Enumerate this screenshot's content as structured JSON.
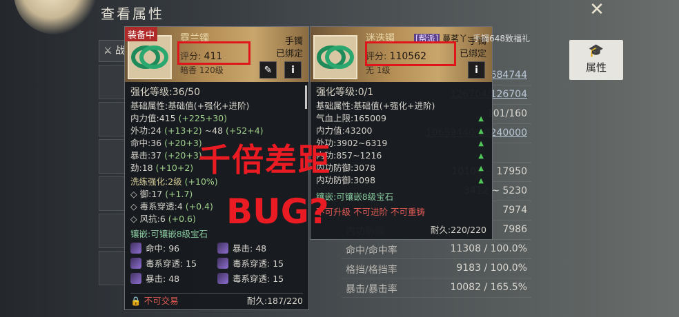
{
  "window": {
    "title": "查看属性"
  },
  "left_tab": {
    "label": "战"
  },
  "right_button": {
    "label": "属性"
  },
  "card1": {
    "badge": "装备中",
    "name": "霓兰镯",
    "score_label": "评分:",
    "score": "411",
    "sub": "暗香   120级",
    "type": "手镯",
    "bound": "已绑定",
    "enhance": "强化等级:36/50",
    "base_label": "基础属性:基础值(+强化+进阶)",
    "attrs": [
      {
        "k": "内力值:",
        "v": "415",
        "g": " (+225+30)"
      },
      {
        "k": "外功:",
        "v": "24",
        "g": " (+13+2)",
        "v2": " ~48",
        "g2": " (+52+4)"
      },
      {
        "k": "命中:",
        "v": "36",
        "g": " (+20+3)"
      },
      {
        "k": "暴击:",
        "v": "37",
        "g": " (+20+3)"
      },
      {
        "k": "劲:",
        "v": "18",
        "g": " (+10+2)"
      }
    ],
    "refine": "洗练强化:2级",
    "refine_pct": " (+10%)",
    "refine_attrs": [
      {
        "k": "◇ 御:",
        "v": "17",
        "g": " (+1.7)"
      },
      {
        "k": "◇ 毒系穿透:",
        "v": "4",
        "g": " (+0.4)"
      },
      {
        "k": "◇ 风抗:",
        "v": "6",
        "g": " (+0.6)"
      }
    ],
    "inlay": "镶嵌:可镶嵌8级宝石",
    "gems": [
      {
        "label": "命中:",
        "value": "96"
      },
      {
        "label": "暴击:",
        "value": "48"
      },
      {
        "label": "毒系穿透:",
        "value": "15"
      },
      {
        "label": "毒系穿透:",
        "value": "15"
      },
      {
        "label": "暴击:",
        "value": "48"
      },
      {
        "label": "毒系穿透:",
        "value": "15"
      }
    ],
    "trade": "不可交易",
    "durability": "耐久:187/220"
  },
  "card2": {
    "name": "迷迭镯",
    "guild_tag": "[帮派]",
    "guild_text": "蔓茗丫:",
    "type": "手镯",
    "bound": "已绑定",
    "score_label": "评分:",
    "score": "110562",
    "sub": "无   1级",
    "enhance": "强化等级:0/1",
    "base_label": "基础属性:基础值(+强化+进阶)",
    "attrs": [
      {
        "k": "气血上限:",
        "v": "165009"
      },
      {
        "k": "内力值:",
        "v": "43200"
      },
      {
        "k": "外功:",
        "v": "3902~6319"
      },
      {
        "k": "内功:",
        "v": "857~1216"
      },
      {
        "k": "内功防御:",
        "v": "3078"
      },
      {
        "k": "内功防御:",
        "v": "3098"
      }
    ],
    "inlay": "镶嵌:可镶嵌8级宝石",
    "restrict": "不可升级 不可进阶 不可重铸",
    "durability": "耐久:220/220"
  },
  "bg_header_text": "手镯648致福礼",
  "stats": [
    {
      "label": "",
      "value": "/684744",
      "ul": true
    },
    {
      "label": "",
      "value": "126704/126704",
      "ul": true
    },
    {
      "label": "",
      "value": "101/160",
      "ul": false
    },
    {
      "label": "",
      "value": "10659440/10240000",
      "ul": true
    },
    {
      "label": "",
      "value": "",
      "ul": false
    },
    {
      "label": "",
      "value": "10104 ~ 17950",
      "ul": false
    },
    {
      "label": "",
      "value": "3412 ~ 5230",
      "ul": false
    },
    {
      "label": "",
      "value": "7974",
      "ul": false
    },
    {
      "label": "内功防御",
      "value": "7986",
      "ul": false
    },
    {
      "label": "命中/命中率",
      "value": "11308 / 100.0%",
      "ul": false
    },
    {
      "label": "格挡/格挡率",
      "value": "9183 / 100.0%",
      "ul": false
    },
    {
      "label": "暴击/暴击率",
      "value": "10082 / 165.5%",
      "ul": false
    }
  ],
  "overlay": {
    "line1": "千倍差距",
    "line2": "BUG?"
  },
  "colors": {
    "highlight": "#e0151b",
    "bonus_green": "#9fd08a",
    "warning_red": "#e25a55"
  }
}
